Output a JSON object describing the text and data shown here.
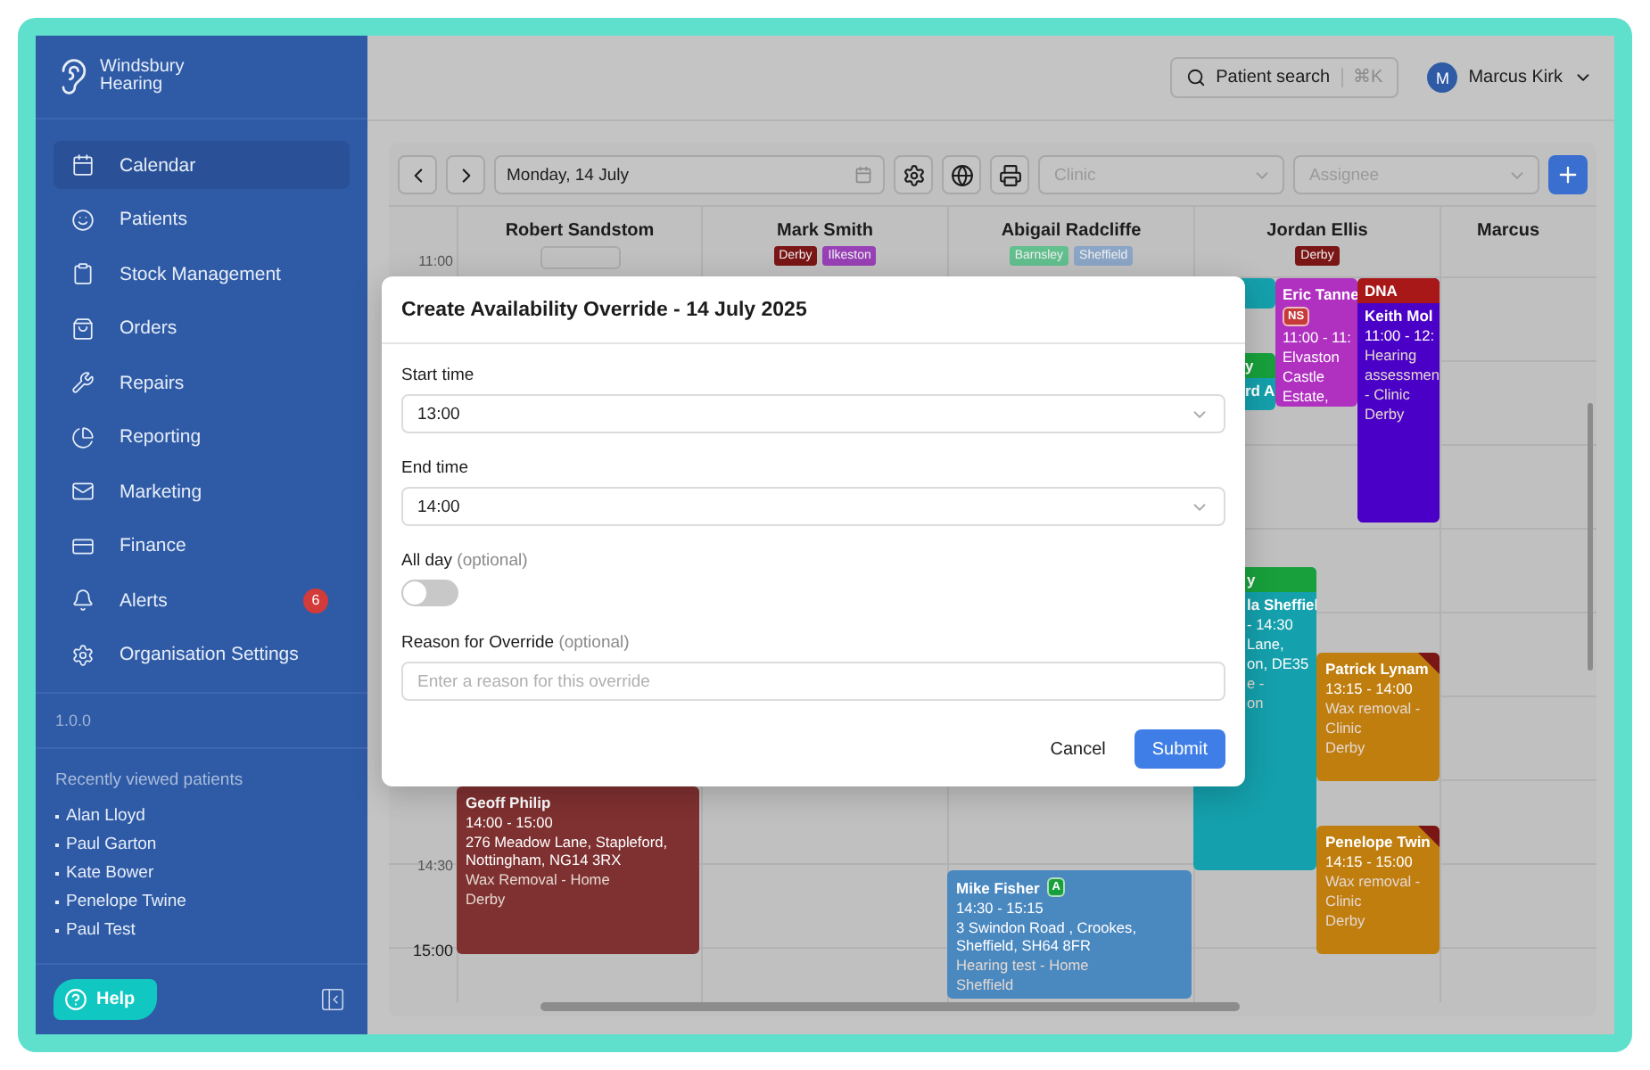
{
  "brand": {
    "name": "Windsbury Hearing"
  },
  "sidebar": {
    "items": [
      {
        "label": "Calendar",
        "selected": true
      },
      {
        "label": "Patients",
        "selected": false
      },
      {
        "label": "Stock Management",
        "selected": false
      },
      {
        "label": "Orders",
        "selected": false
      },
      {
        "label": "Repairs",
        "selected": false
      },
      {
        "label": "Reporting",
        "selected": false
      },
      {
        "label": "Marketing",
        "selected": false
      },
      {
        "label": "Finance",
        "selected": false
      },
      {
        "label": "Alerts",
        "selected": false,
        "badge": "6"
      },
      {
        "label": "Organisation Settings",
        "selected": false
      }
    ],
    "version": "1.0.0",
    "recent": {
      "title": "Recently viewed patients",
      "patients": [
        "Alan Lloyd",
        "Paul Garton",
        "Kate Bower",
        "Penelope Twine",
        "Paul Test"
      ]
    },
    "help": "Help"
  },
  "header": {
    "search": {
      "label": "Patient search",
      "shortcut": "⌘K"
    },
    "user": {
      "initial": "M",
      "name": "Marcus Kirk"
    }
  },
  "toolbar": {
    "date": "Monday, 14 July",
    "clinic": {
      "placeholder": "Clinic"
    },
    "assignee": {
      "placeholder": "Assignee"
    }
  },
  "columns": [
    {
      "name": "Robert Sandstom",
      "empty_tag": true
    },
    {
      "name": "Mark Smith",
      "tags": [
        {
          "label": "Derby",
          "color": "#7a1616"
        },
        {
          "label": "Ilkeston",
          "color": "#9840b6"
        }
      ]
    },
    {
      "name": "Abigail Radcliffe",
      "tags": [
        {
          "label": "Barnsley",
          "color": "#62bf8e"
        },
        {
          "label": "Sheffield",
          "color": "#8ba5c6"
        }
      ]
    },
    {
      "name": "Jordan Ellis",
      "tags": [
        {
          "label": "Derby",
          "color": "#7a1616"
        }
      ]
    },
    {
      "name": "Marcus"
    }
  ],
  "times": [
    "11:00",
    "14:30",
    "15:00"
  ],
  "events": [
    {
      "color": "#14a0ac"
    },
    {
      "color": "#14a0ac",
      "header": {
        "label": "y",
        "color": "#18a03c"
      },
      "title": "rd A"
    },
    {
      "color": "#14a0ac",
      "header": {
        "label": "y",
        "color": "#18a03c"
      },
      "title": "la Sheffiel",
      "lines": [
        {
          "text": "- 14:30",
          "kind": "strong"
        },
        {
          "text": "Lane,",
          "kind": "strong"
        },
        {
          "text": "on, DE35",
          "kind": "strong"
        },
        {
          "text": "e -",
          "kind": "muted"
        },
        {
          "text": "on",
          "kind": "muted"
        }
      ]
    },
    {
      "color": "#b030c0",
      "title": "Eric Tanne",
      "badge": {
        "label": "NS",
        "color": "#c83a3a"
      },
      "lines": [
        {
          "text": "11:00 - 11:",
          "kind": "strong"
        },
        {
          "text": "Elvaston",
          "kind": "strong"
        },
        {
          "text": "Castle",
          "kind": "strong"
        },
        {
          "text": "Estate,",
          "kind": "strong"
        }
      ]
    },
    {
      "color": "#4a00c6",
      "header": {
        "label": "DNA",
        "color": "#a81818"
      },
      "title": "Keith Mol",
      "lines": [
        {
          "text": "11:00 - 12:",
          "kind": "strong"
        },
        {
          "text": "Hearing",
          "kind": "muted"
        },
        {
          "text": "assessmen",
          "kind": "muted"
        },
        {
          "text": "- Clinic",
          "kind": "muted"
        },
        {
          "text": "Derby",
          "kind": "muted"
        }
      ]
    },
    {
      "color": "#c07e0e",
      "flag": true,
      "title": "Patrick Lynam",
      "lines": [
        {
          "text": "13:15 - 14:00",
          "kind": "strong"
        },
        {
          "text": "Wax removal -",
          "kind": "muted"
        },
        {
          "text": "Clinic",
          "kind": "muted"
        },
        {
          "text": "Derby",
          "kind": "muted"
        }
      ]
    },
    {
      "color": "#c07e0e",
      "flag": true,
      "title": "Penelope Twin",
      "lines": [
        {
          "text": "14:15 - 15:00",
          "kind": "strong"
        },
        {
          "text": "Wax removal -",
          "kind": "muted"
        },
        {
          "text": "Clinic",
          "kind": "muted"
        },
        {
          "text": "Derby",
          "kind": "muted"
        }
      ]
    },
    {
      "color": "#7f3030",
      "title": "Geoff Philip",
      "lines": [
        {
          "text": "14:00 - 15:00",
          "kind": "strong"
        },
        {
          "text": "276 Meadow Lane, Stapleford, Nottingham, NG14 3RX",
          "kind": "strong"
        },
        {
          "text": "Wax Removal - Home",
          "kind": "muted"
        },
        {
          "text": "Derby",
          "kind": "muted"
        }
      ]
    },
    {
      "color": "#4a88c0",
      "title": "Mike Fisher",
      "badge": {
        "label": "A",
        "color": "#18a03c"
      },
      "lines": [
        {
          "text": "14:30 - 15:15",
          "kind": "strong"
        },
        {
          "text": "3 Swindon Road , Crookes, Sheffield, SH64 8FR",
          "kind": "strong"
        },
        {
          "text": "Hearing test - Home",
          "kind": "muted"
        },
        {
          "text": "Sheffield",
          "kind": "muted"
        }
      ]
    }
  ],
  "modal": {
    "title": "Create Availability Override - 14 July 2025",
    "start": {
      "label": "Start time",
      "value": "13:00"
    },
    "end": {
      "label": "End time",
      "value": "14:00"
    },
    "all_day": {
      "label": "All day",
      "hint": "(optional)",
      "on": false
    },
    "reason": {
      "label": "Reason for Override",
      "hint": "(optional)",
      "placeholder": "Enter a reason for this override"
    },
    "cancel": "Cancel",
    "submit": "Submit"
  }
}
